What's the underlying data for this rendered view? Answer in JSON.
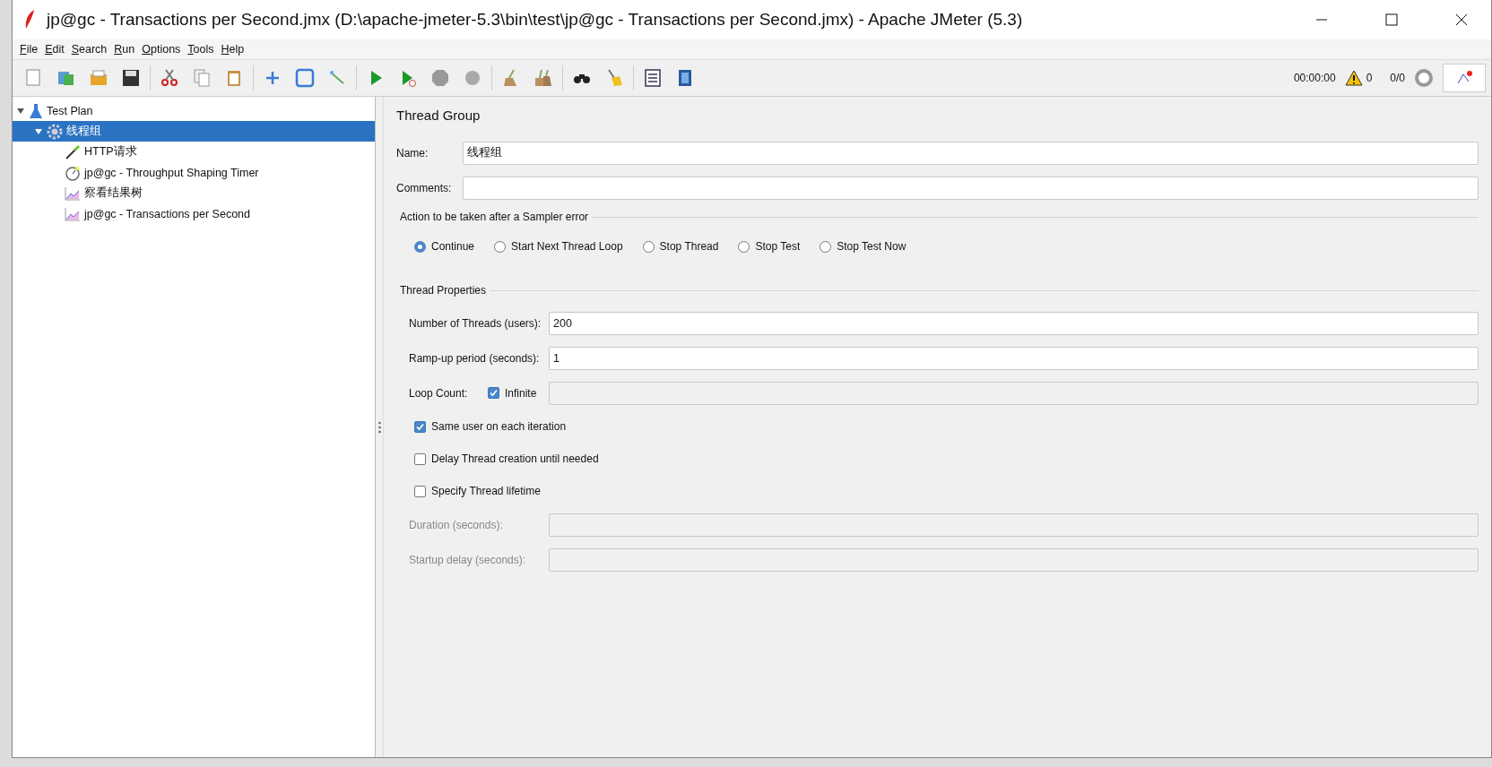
{
  "window": {
    "title": "jp@gc - Transactions per Second.jmx (D:\\apache-jmeter-5.3\\bin\\test\\jp@gc - Transactions per Second.jmx) - Apache JMeter (5.3)"
  },
  "menu": [
    "File",
    "Edit",
    "Search",
    "Run",
    "Options",
    "Tools",
    "Help"
  ],
  "status": {
    "timer": "00:00:00",
    "warnings": "0",
    "threads": "0/0"
  },
  "tree": [
    {
      "label": "Test Plan",
      "kind": "plan",
      "selected": false,
      "expanded": true,
      "children": [
        {
          "label": "线程组",
          "kind": "group",
          "selected": true,
          "expanded": true,
          "children": [
            {
              "label": "HTTP请求",
              "kind": "sampler",
              "selected": false
            },
            {
              "label": "jp@gc - Throughput Shaping Timer",
              "kind": "timer",
              "selected": false
            },
            {
              "label": "察看结果树",
              "kind": "listener",
              "selected": false
            },
            {
              "label": "jp@gc - Transactions per Second",
              "kind": "listener",
              "selected": false
            }
          ]
        }
      ]
    }
  ],
  "panel": {
    "title": "Thread Group",
    "name_label": "Name:",
    "name_value": "线程组",
    "comments_label": "Comments:",
    "error_section": "Action to be taken after a Sampler error",
    "error_actions": [
      {
        "label": "Continue",
        "selected": true
      },
      {
        "label": "Start Next Thread Loop",
        "selected": false
      },
      {
        "label": "Stop Thread",
        "selected": false
      },
      {
        "label": "Stop Test",
        "selected": false
      },
      {
        "label": "Stop Test Now",
        "selected": false
      }
    ],
    "properties_section": "Thread Properties",
    "threads_label": "Number of Threads (users):",
    "threads_value": "200",
    "rampup_label": "Ramp-up period (seconds):",
    "rampup_value": "1",
    "loop_label": "Loop Count:",
    "infinite_label": "Infinite",
    "infinite_checked": true,
    "options": [
      {
        "label": "Same user on each iteration",
        "checked": true
      },
      {
        "label": "Delay Thread creation until needed",
        "checked": false
      },
      {
        "label": "Specify Thread lifetime",
        "checked": false
      }
    ],
    "duration_label": "Duration (seconds):",
    "duration_disabled": true,
    "startup_label": "Startup delay (seconds):",
    "startup_disabled": true
  }
}
